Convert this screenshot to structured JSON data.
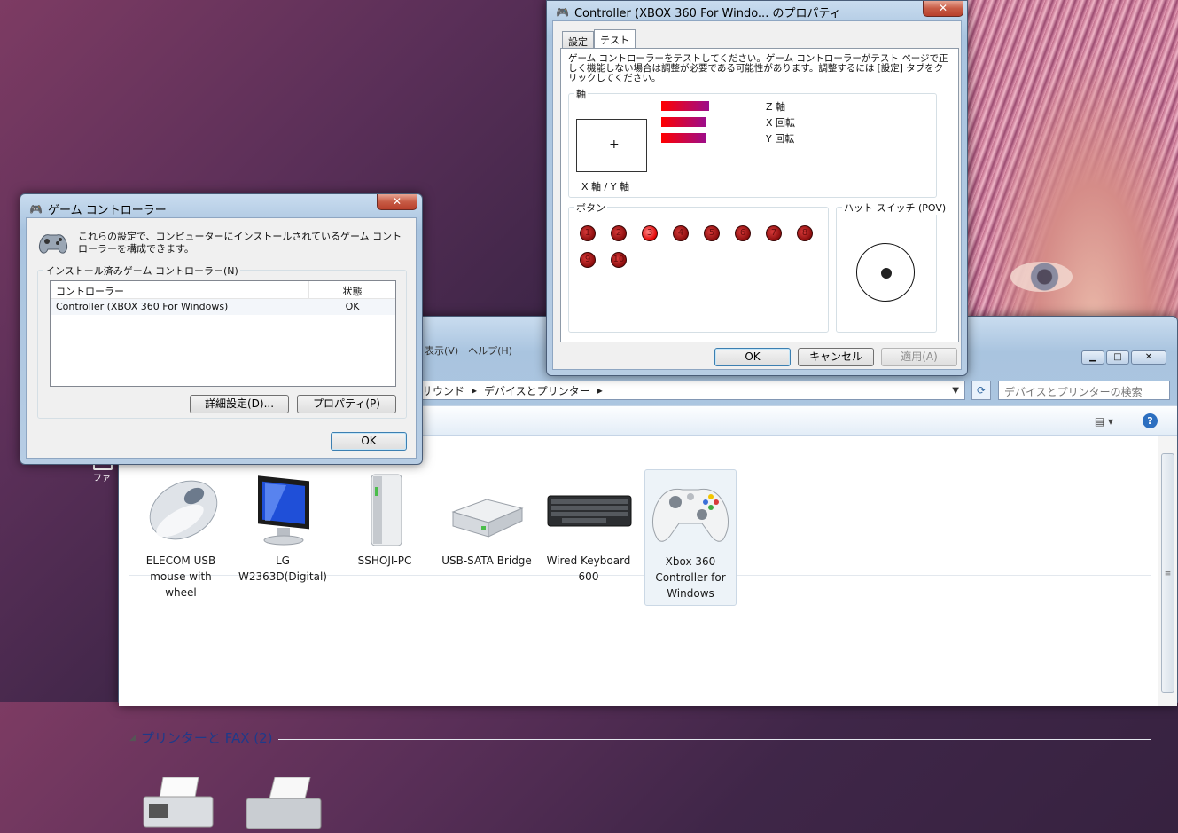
{
  "explorer": {
    "menu_hint": "表示(V)　ヘルプ(H)",
    "breadcrumb": [
      "サウンド",
      "デバイスとプリンター"
    ],
    "search_placeholder": "デバイスとプリンターの検索",
    "devices": [
      {
        "label": "ELECOM USB mouse with wheel",
        "icon": "mouse-icon"
      },
      {
        "label": "LG W2363D(Digital)",
        "icon": "monitor-icon"
      },
      {
        "label": "SSHOJI-PC",
        "icon": "computer-icon"
      },
      {
        "label": "USB-SATA Bridge",
        "icon": "drive-icon"
      },
      {
        "label": "Wired Keyboard 600",
        "icon": "keyboard-icon"
      },
      {
        "label": "Xbox 360 Controller for Windows",
        "icon": "gamepad-icon",
        "selected": true
      }
    ],
    "printers_section": {
      "title": "プリンターと FAX (2)"
    }
  },
  "desktop_icon_label": "ファ",
  "gc_dialog": {
    "title": "ゲーム コントローラー",
    "description": "これらの設定で、コンピューターにインストールされているゲーム コントローラーを構成できます。",
    "group_label": "インストール済みゲーム コントローラー(N)",
    "columns": [
      "コントローラー",
      "状態"
    ],
    "rows": [
      {
        "controller": "Controller (XBOX 360 For Windows)",
        "status": "OK"
      }
    ],
    "advanced_button": "詳細設定(D)...",
    "properties_button": "プロパティ(P)",
    "ok_button": "OK"
  },
  "prop_dialog": {
    "title": "Controller (XBOX 360 For Windo... のプロパティ",
    "tabs": [
      "設定",
      "テスト"
    ],
    "active_tab": "テスト",
    "description": "ゲーム コントローラーをテストしてください。ゲーム コントローラーがテスト ページで正しく機能しない場合は調整が必要である可能性があります。調整するには [設定] タブをクリックしてください。",
    "axes_group": "軸",
    "xy_label": "X 軸 / Y 軸",
    "axes": [
      {
        "name": "Z 軸",
        "level": 0.5
      },
      {
        "name": "X 回転",
        "level": 0.5
      },
      {
        "name": "Y 回転",
        "level": 0.5
      }
    ],
    "buttons_group": "ボタン",
    "buttons": [
      {
        "num": "1",
        "pressed": false
      },
      {
        "num": "2",
        "pressed": false
      },
      {
        "num": "3",
        "pressed": true
      },
      {
        "num": "4",
        "pressed": false
      },
      {
        "num": "5",
        "pressed": false
      },
      {
        "num": "6",
        "pressed": false
      },
      {
        "num": "7",
        "pressed": false
      },
      {
        "num": "8",
        "pressed": false
      },
      {
        "num": "9",
        "pressed": false
      },
      {
        "num": "10",
        "pressed": false
      }
    ],
    "pov_group": "ハット スイッチ (POV)",
    "ok_button": "OK",
    "cancel_button": "キャンセル",
    "apply_button": "適用(A)"
  }
}
